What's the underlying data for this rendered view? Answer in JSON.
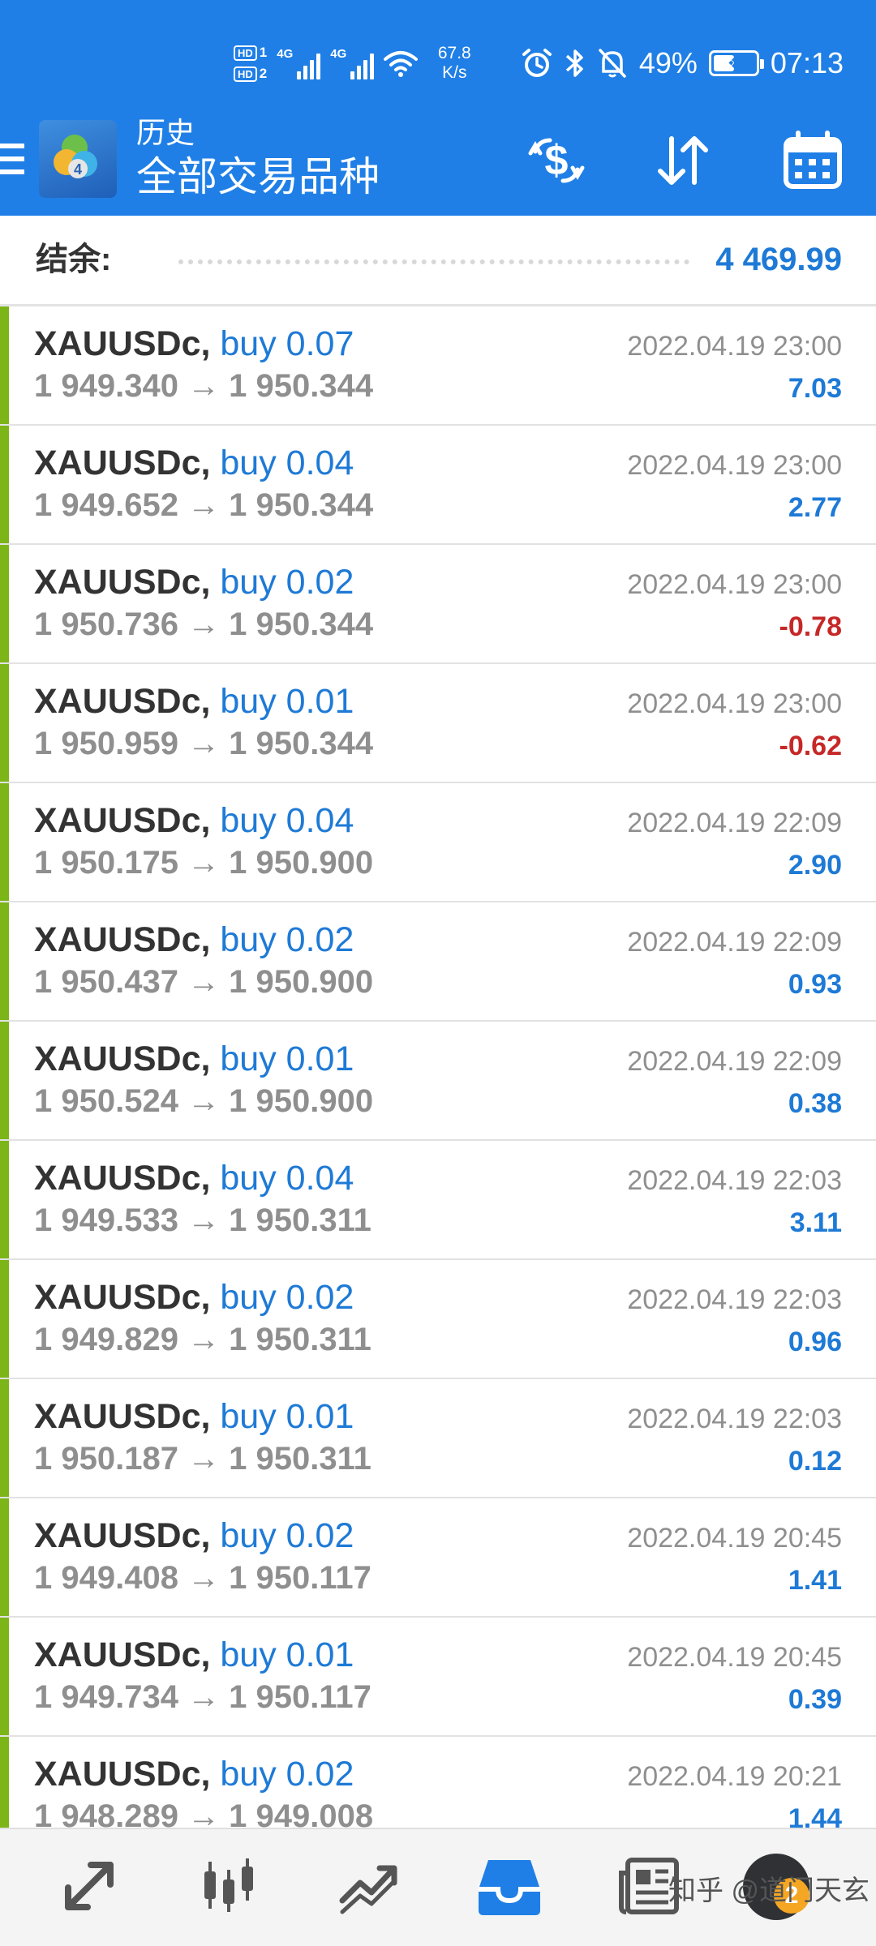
{
  "status_bar": {
    "hd1": "HD",
    "hd1_n": "1",
    "hd2": "HD",
    "hd2_n": "2",
    "net1": "4G",
    "net2": "4G",
    "speed_value": "67.8",
    "speed_unit": "K/s",
    "battery_percent": "49%",
    "battery_level": 0.49,
    "time": "07:13"
  },
  "header": {
    "section": "历史",
    "filter": "全部交易品种"
  },
  "balance": {
    "label": "结余:",
    "value": "4 469.99"
  },
  "deals": [
    {
      "symbol": "XAUUSDc,",
      "side": "buy 0.07",
      "prices": "1 949.340 → 1 950.344",
      "time": "2022.04.19 23:00",
      "profit": "7.03",
      "profit_sign": "pos"
    },
    {
      "symbol": "XAUUSDc,",
      "side": "buy 0.04",
      "prices": "1 949.652 → 1 950.344",
      "time": "2022.04.19 23:00",
      "profit": "2.77",
      "profit_sign": "pos"
    },
    {
      "symbol": "XAUUSDc,",
      "side": "buy 0.02",
      "prices": "1 950.736 → 1 950.344",
      "time": "2022.04.19 23:00",
      "profit": "-0.78",
      "profit_sign": "neg"
    },
    {
      "symbol": "XAUUSDc,",
      "side": "buy 0.01",
      "prices": "1 950.959 → 1 950.344",
      "time": "2022.04.19 23:00",
      "profit": "-0.62",
      "profit_sign": "neg"
    },
    {
      "symbol": "XAUUSDc,",
      "side": "buy 0.04",
      "prices": "1 950.175 → 1 950.900",
      "time": "2022.04.19 22:09",
      "profit": "2.90",
      "profit_sign": "pos"
    },
    {
      "symbol": "XAUUSDc,",
      "side": "buy 0.02",
      "prices": "1 950.437 → 1 950.900",
      "time": "2022.04.19 22:09",
      "profit": "0.93",
      "profit_sign": "pos"
    },
    {
      "symbol": "XAUUSDc,",
      "side": "buy 0.01",
      "prices": "1 950.524 → 1 950.900",
      "time": "2022.04.19 22:09",
      "profit": "0.38",
      "profit_sign": "pos"
    },
    {
      "symbol": "XAUUSDc,",
      "side": "buy 0.04",
      "prices": "1 949.533 → 1 950.311",
      "time": "2022.04.19 22:03",
      "profit": "3.11",
      "profit_sign": "pos"
    },
    {
      "symbol": "XAUUSDc,",
      "side": "buy 0.02",
      "prices": "1 949.829 → 1 950.311",
      "time": "2022.04.19 22:03",
      "profit": "0.96",
      "profit_sign": "pos"
    },
    {
      "symbol": "XAUUSDc,",
      "side": "buy 0.01",
      "prices": "1 950.187 → 1 950.311",
      "time": "2022.04.19 22:03",
      "profit": "0.12",
      "profit_sign": "pos"
    },
    {
      "symbol": "XAUUSDc,",
      "side": "buy 0.02",
      "prices": "1 949.408 → 1 950.117",
      "time": "2022.04.19 20:45",
      "profit": "1.41",
      "profit_sign": "pos"
    },
    {
      "symbol": "XAUUSDc,",
      "side": "buy 0.01",
      "prices": "1 949.734 → 1 950.117",
      "time": "2022.04.19 20:45",
      "profit": "0.39",
      "profit_sign": "pos"
    },
    {
      "symbol": "XAUUSDc,",
      "side": "buy 0.02",
      "prices": "1 948.289 → 1 949.008",
      "time": "2022.04.19 20:21",
      "profit": "1.44",
      "profit_sign": "pos"
    }
  ],
  "bottom_nav": {
    "items": [
      "quotes-icon",
      "chart-icon",
      "trade-icon",
      "history-icon",
      "news-icon",
      "chat-icon"
    ],
    "active": "history-icon",
    "watermark": "知乎 @道门天玄",
    "badge": "2"
  },
  "colors": {
    "header_bg": "#1f7fe6",
    "accent_blue": "#1e7ad6",
    "loss_red": "#c62828",
    "row_accent": "#7cb518"
  }
}
